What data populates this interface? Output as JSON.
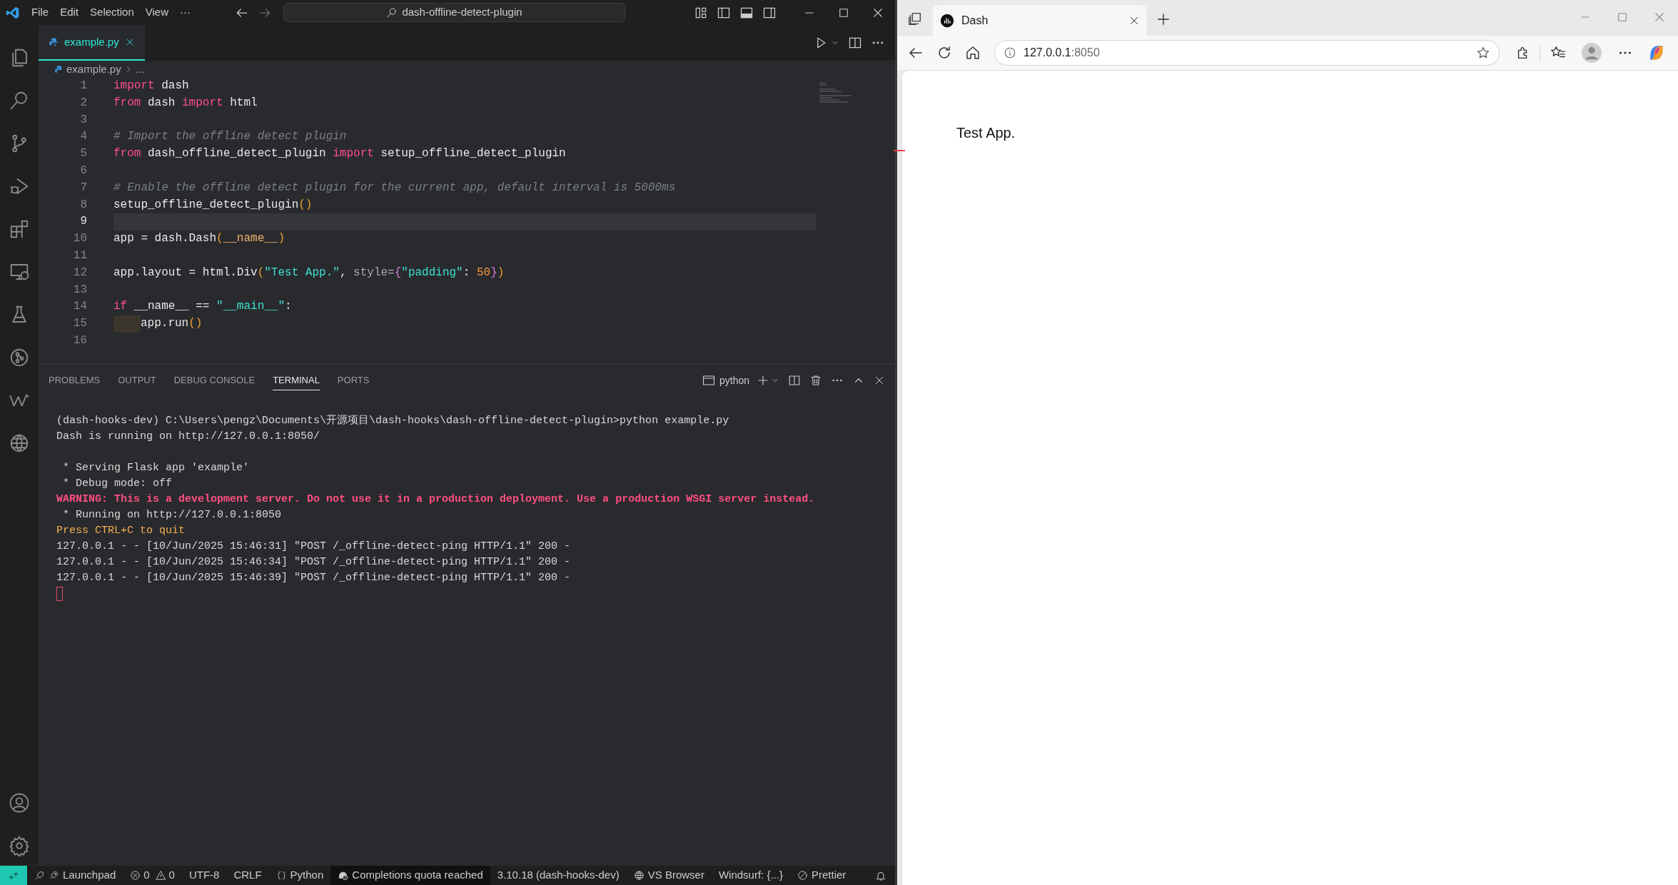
{
  "editor_window": {
    "menu": [
      "File",
      "Edit",
      "Selection",
      "View",
      "···"
    ],
    "command_center": "dash-offline-detect-plugin",
    "tabs": [
      {
        "label": "example.py",
        "selected": true
      }
    ],
    "breadcrumb": [
      "example.py",
      "..."
    ],
    "code_lines": [
      {
        "number": "1",
        "tokens": [
          {
            "kind": "keyword",
            "text": "import"
          },
          {
            "kind": "plain",
            "text": " dash"
          }
        ]
      },
      {
        "number": "2",
        "tokens": [
          {
            "kind": "keyword",
            "text": "from"
          },
          {
            "kind": "plain",
            "text": " dash "
          },
          {
            "kind": "keyword",
            "text": "import"
          },
          {
            "kind": "plain",
            "text": " html"
          }
        ]
      },
      {
        "number": "3"
      },
      {
        "number": "4",
        "tokens": [
          {
            "kind": "comment",
            "text": "# Import the offline detect plugin"
          }
        ]
      },
      {
        "number": "5",
        "tokens": [
          {
            "kind": "keyword",
            "text": "from"
          },
          {
            "kind": "plain",
            "text": " dash_offline_detect_plugin "
          },
          {
            "kind": "keyword",
            "text": "import"
          },
          {
            "kind": "plain",
            "text": " setup_offline_detect_plugin"
          }
        ]
      },
      {
        "number": "6"
      },
      {
        "number": "7",
        "tokens": [
          {
            "kind": "comment",
            "text": "# Enable the offline detect plugin for the current app, default interval is 5000ms"
          }
        ]
      },
      {
        "number": "8",
        "tokens": [
          {
            "kind": "plain",
            "text": "setup_offline_detect_plugin"
          },
          {
            "kind": "paren",
            "text": "()"
          }
        ]
      },
      {
        "number": "9",
        "current": true
      },
      {
        "number": "10",
        "tokens": [
          {
            "kind": "plain",
            "text": "app = dash.Dash"
          },
          {
            "kind": "paren",
            "text": "("
          },
          {
            "kind": "special",
            "text": "__name__"
          },
          {
            "kind": "paren",
            "text": ")"
          }
        ]
      },
      {
        "number": "11"
      },
      {
        "number": "12",
        "tokens": [
          {
            "kind": "plain",
            "text": "app.layout = html.Div"
          },
          {
            "kind": "paren",
            "text": "("
          },
          {
            "kind": "string",
            "text": "\"Test App.\""
          },
          {
            "kind": "plain",
            "text": ", "
          },
          {
            "kind": "param",
            "text": "style="
          },
          {
            "kind": "brace",
            "text": "{"
          },
          {
            "kind": "string",
            "text": "\"padding\""
          },
          {
            "kind": "plain",
            "text": ": "
          },
          {
            "kind": "number",
            "text": "50"
          },
          {
            "kind": "brace",
            "text": "}"
          },
          {
            "kind": "paren",
            "text": ")"
          }
        ]
      },
      {
        "number": "13"
      },
      {
        "number": "14",
        "tokens": [
          {
            "kind": "keyword",
            "text": "if"
          },
          {
            "kind": "plain",
            "text": " __name__ == "
          },
          {
            "kind": "string",
            "text": "\"__main__\""
          },
          {
            "kind": "plain",
            "text": ":"
          }
        ]
      },
      {
        "number": "15",
        "indented": true,
        "tokens": [
          {
            "kind": "plain",
            "text": "app.run"
          },
          {
            "kind": "paren",
            "text": "()"
          }
        ]
      },
      {
        "number": "16"
      }
    ],
    "panel_tabs": [
      {
        "label": "PROBLEMS",
        "selected": false
      },
      {
        "label": "OUTPUT",
        "selected": false
      },
      {
        "label": "DEBUG CONSOLE",
        "selected": false
      },
      {
        "label": "TERMINAL",
        "selected": true
      },
      {
        "label": "PORTS",
        "selected": false
      }
    ],
    "terminal_name": "python",
    "terminal_lines": [
      {
        "kind": "normal",
        "text": "(dash-hooks-dev) C:\\Users\\pengz\\Documents\\开源项目\\dash-hooks\\dash-offline-detect-plugin>python example.py"
      },
      {
        "kind": "normal",
        "text": "Dash is running on http://127.0.0.1:8050/"
      },
      {
        "kind": "blank"
      },
      {
        "kind": "normal",
        "text": " * Serving Flask app 'example'"
      },
      {
        "kind": "normal",
        "text": " * Debug mode: off"
      },
      {
        "kind": "warning",
        "text": "WARNING: This is a development server. Do not use it in a production deployment. Use a production WSGI server instead."
      },
      {
        "kind": "normal",
        "text": " * Running on http://127.0.0.1:8050"
      },
      {
        "kind": "hint",
        "text": "Press CTRL+C to quit"
      },
      {
        "kind": "normal",
        "text": "127.0.0.1 - - [10/Jun/2025 15:46:31] \"POST /_offline-detect-ping HTTP/1.1\" 200 -"
      },
      {
        "kind": "normal",
        "text": "127.0.0.1 - - [10/Jun/2025 15:46:34] \"POST /_offline-detect-ping HTTP/1.1\" 200 -"
      },
      {
        "kind": "normal",
        "text": "127.0.0.1 - - [10/Jun/2025 15:46:39] \"POST /_offline-detect-ping HTTP/1.1\" 200 -"
      }
    ],
    "status_bar": [
      {
        "kind": "launchpad",
        "text": "Launchpad"
      },
      {
        "kind": "problems",
        "errors": "0",
        "warnings": "0"
      },
      {
        "kind": "text",
        "text": "UTF-8"
      },
      {
        "kind": "text",
        "text": "CRLF"
      },
      {
        "kind": "language",
        "text": "Python"
      },
      {
        "kind": "completions",
        "text": "Completions quota reached"
      },
      {
        "kind": "text",
        "text": "3.10.18 (dash-hooks-dev)"
      },
      {
        "kind": "browser",
        "text": "VS Browser"
      },
      {
        "kind": "text",
        "text": "Windsurf: {...}"
      },
      {
        "kind": "prettier",
        "text": "Prettier"
      },
      {
        "kind": "bell"
      }
    ]
  },
  "browser_window": {
    "tabs": [
      {
        "label": "Dash",
        "selected": true
      }
    ],
    "address": {
      "host": "127.0.0.1",
      "port": ":8050"
    },
    "page_text": "Test App."
  }
}
